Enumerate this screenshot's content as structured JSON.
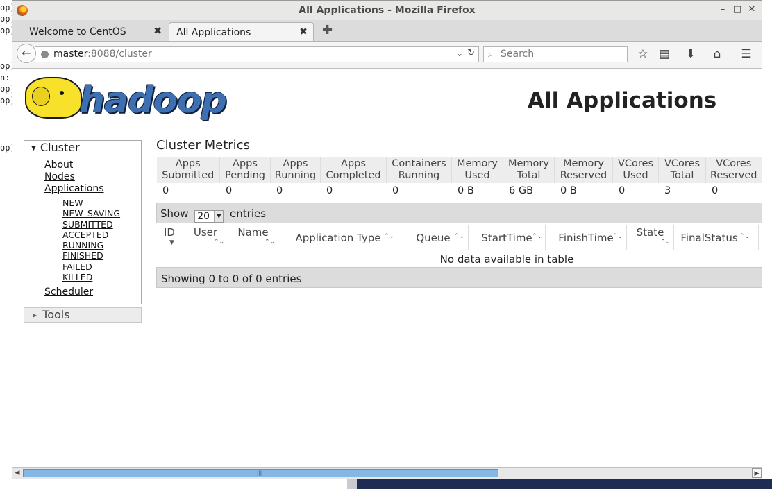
{
  "terminal_fragments": [
    "op]",
    "op]",
    "op]",
    "op]",
    "n:",
    "op]",
    "op]",
    "op]"
  ],
  "window": {
    "title": "All Applications - Mozilla Firefox",
    "min": "–",
    "max": "□",
    "close": "✕"
  },
  "tabs": [
    {
      "label": "Welcome to CentOS",
      "close": "✖"
    },
    {
      "label": "All Applications",
      "close": "✖"
    }
  ],
  "new_tab": "✚",
  "nav": {
    "back": "←",
    "url_host": "master",
    "url_rest": ":8088/cluster",
    "url_dropdown": "⌄",
    "reload": "↻",
    "search_placeholder": "Search",
    "search_icon": "⌕",
    "bookmark": "☆",
    "reader": "▤",
    "download": "⬇",
    "home": "⌂",
    "menu": "☰"
  },
  "page": {
    "logo_text": "hadoop",
    "title": "All Applications"
  },
  "sidebar": {
    "cluster_label": "Cluster",
    "cluster_toggle": "▼",
    "links": [
      "About",
      "Nodes",
      "Applications"
    ],
    "app_states": [
      "NEW",
      "NEW_SAVING",
      "SUBMITTED",
      "ACCEPTED",
      "RUNNING",
      "FINISHED",
      "FAILED",
      "KILLED"
    ],
    "scheduler": "Scheduler",
    "tools_label": "Tools",
    "tools_toggle": "▶"
  },
  "cluster_metrics": {
    "title": "Cluster Metrics",
    "headers": [
      [
        "Apps",
        "Submitted"
      ],
      [
        "Apps",
        "Pending"
      ],
      [
        "Apps",
        "Running"
      ],
      [
        "Apps",
        "Completed"
      ],
      [
        "Containers",
        "Running"
      ],
      [
        "Memory",
        "Used"
      ],
      [
        "Memory",
        "Total"
      ],
      [
        "Memory",
        "Reserved"
      ],
      [
        "VCores",
        "Used"
      ],
      [
        "VCores",
        "Total"
      ],
      [
        "VCores",
        "Reserved"
      ]
    ],
    "values": [
      "0",
      "0",
      "0",
      "0",
      "0",
      "0 B",
      "6 GB",
      "0 B",
      "0",
      "3",
      "0"
    ]
  },
  "apps_table": {
    "show_label": "Show",
    "page_size": "20",
    "entries_label": "entries",
    "columns": [
      "ID",
      "User",
      "Name",
      "Application Type",
      "Queue",
      "StartTime",
      "FinishTime",
      "State",
      "FinalStatus"
    ],
    "empty_message": "No data available in table",
    "footer": "Showing 0 to 0 of 0 entries"
  },
  "scrollbar": {
    "left": "◀",
    "right": "▶",
    "grip": "|||"
  }
}
